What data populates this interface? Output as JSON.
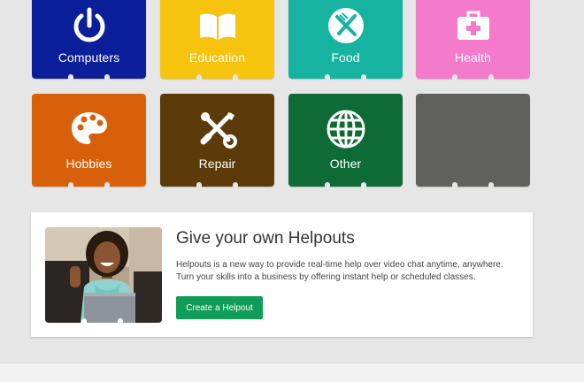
{
  "colors": {
    "page_background": "#e6e6e6",
    "computers": "#0b1f9a",
    "education": "#f6c40f",
    "food": "#15b3a0",
    "health": "#f47acb",
    "hobbies": "#d9600b",
    "repair": "#5c3a09",
    "other": "#0e6b36",
    "empty": "#60615e",
    "accent_button": "#0f9d58"
  },
  "categories": [
    {
      "label": "Computers",
      "icon": "power-icon"
    },
    {
      "label": "Education",
      "icon": "open-book-icon"
    },
    {
      "label": "Food",
      "icon": "fork-knife-icon"
    },
    {
      "label": "Health",
      "icon": "first-aid-kit-icon"
    },
    {
      "label": "Hobbies",
      "icon": "palette-icon"
    },
    {
      "label": "Repair",
      "icon": "wrench-screwdriver-icon"
    },
    {
      "label": "Other",
      "icon": "globe-icon"
    },
    {
      "label": "",
      "icon": ""
    }
  ],
  "promo": {
    "title": "Give your own Helpouts",
    "description": "Helpouts is a new way to provide real-time help over video chat anytime, anywhere. Turn your skills into a business by offering instant help or scheduled classes.",
    "button_label": "Create a Helpout"
  }
}
